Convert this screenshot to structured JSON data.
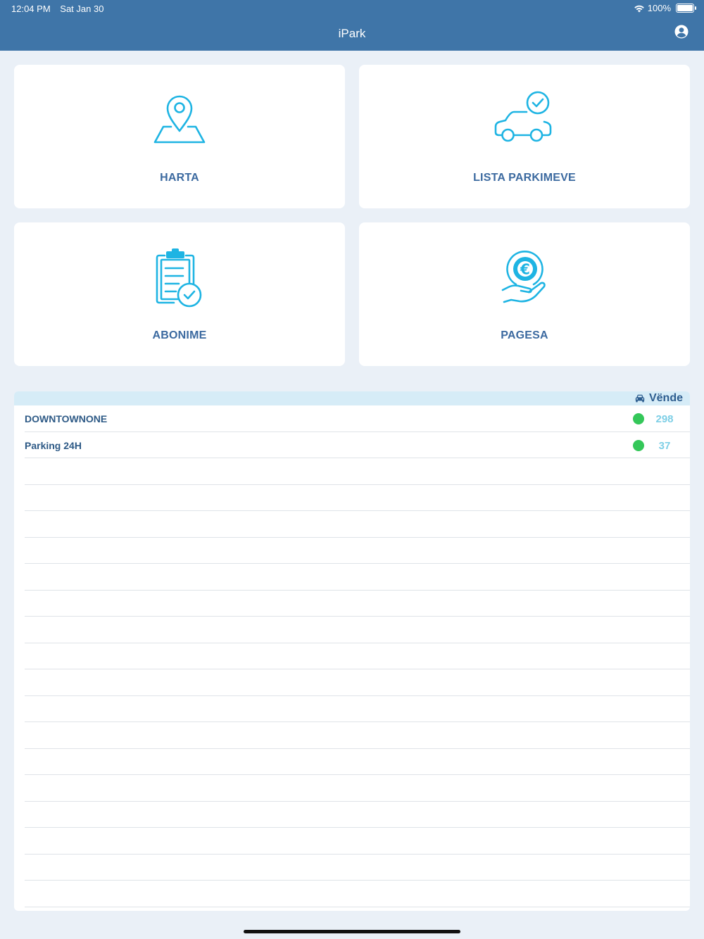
{
  "status_bar": {
    "time": "12:04 PM",
    "date": "Sat Jan 30",
    "battery": "100%"
  },
  "app": {
    "title": "iPark",
    "profile_icon": "user-circle-icon",
    "accent_color": "#3f75a8",
    "icon_color": "#1eb4e3"
  },
  "tiles": [
    {
      "label": "HARTA",
      "icon": "map-pin-icon"
    },
    {
      "label": "LISTA PARKIMEVE",
      "icon": "car-check-icon"
    },
    {
      "label": "ABONIME",
      "icon": "clipboard-check-icon"
    },
    {
      "label": "PAGESA",
      "icon": "euro-hand-icon"
    }
  ],
  "parking_list": {
    "header_label": "Vënde",
    "header_icon": "car-icon",
    "rows": [
      {
        "name": "DOWNTOWNONE",
        "count": "298",
        "status_color": "#34c759"
      },
      {
        "name": "Parking 24H",
        "count": "37",
        "status_color": "#34c759"
      }
    ]
  }
}
